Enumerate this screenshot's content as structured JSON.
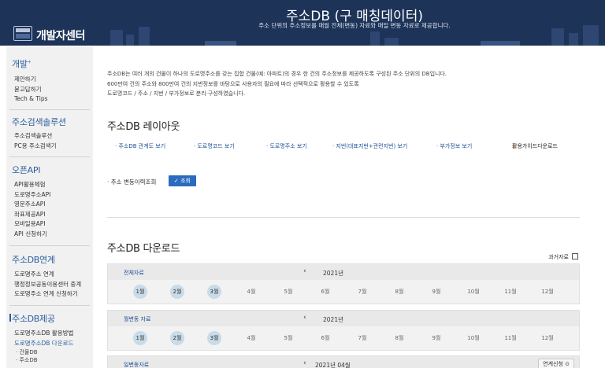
{
  "header": {
    "brand": "개발자센터",
    "title": "주소DB (구 매칭데이터)",
    "subtitle": "주소 단위의 주소정보를 매월 전체(변동) 자료와 매일 변동 자료로 제공합니다.",
    "bg_color": "#1d3358"
  },
  "sidebar": {
    "dev": {
      "title": "개발",
      "items": [
        "제안하기",
        "묻고답하기",
        "Tech & Tips"
      ]
    },
    "search": {
      "title": "주소검색솔루션",
      "items": [
        "주소검색솔루션",
        "PC용 주소검색기"
      ]
    },
    "api": {
      "title": "오픈API",
      "items": [
        "API활용체험",
        "도로명주소API",
        "영문주소API",
        "좌표제공API",
        "모바일용API",
        "API 신청하기"
      ]
    },
    "link": {
      "title": "주소DB연계",
      "items": [
        "도로명주소 연계",
        "행정정보공동이용센터 중계",
        "도로명주소 연계 신청하기"
      ]
    },
    "provide": {
      "title": "주소DB제공",
      "items": [
        "도로명주소DB 활용방법",
        "도로명주소DB 다운로드"
      ],
      "subs": [
        "· 건물DB",
        "· 주소DB"
      ]
    }
  },
  "main": {
    "desc": [
      "주소DB는 여러 개의 건물이 하나의 도로명주소를 갖는 집합 건물(예: 아파트)의 경우 한 건의 주소정보를 제공하도록 구성된 주소 단위의 DB입니다.",
      "600만여 건의 주소와 800만여 건의 지번정보를 바탕으로 사용자의 필요에 따라 선택적으로 활용할 수 있도록",
      "도로명코드 / 주소 / 지번 / 부가정보로 분리·구성하였습니다."
    ],
    "layout_title": "주소DB 레이아웃",
    "links": [
      "· 주소DB 관계도 보기",
      "· 도로명코드 보기",
      "· 도로명주소 보기",
      "· 지번(대표지번+관련지번) 보기",
      "· 부가정보 보기"
    ],
    "guide_download": "활용가이드다운로드",
    "history_label": "· 주소 변동이력조회",
    "query_button": "✓ 조회",
    "download_title": "주소DB 다운로드",
    "past_data": "과거자료",
    "panels": [
      {
        "name": "전체자료",
        "prev": "‹",
        "year": "2021년",
        "months": [
          "1월",
          "2월",
          "3월",
          "4월",
          "5월",
          "6월",
          "7월",
          "8월",
          "9월",
          "10월",
          "11월",
          "12월"
        ],
        "available": 3
      },
      {
        "name": "월변동 자료",
        "prev": "‹",
        "year": "2021년",
        "months": [
          "1월",
          "2월",
          "3월",
          "4월",
          "5월",
          "6월",
          "7월",
          "8월",
          "9월",
          "10월",
          "11월",
          "12월"
        ],
        "available": 3
      },
      {
        "name": "일변동자료",
        "prev": "‹",
        "year": "2021년 04월",
        "request": "연계신청 ⊙"
      }
    ],
    "accent_color": "#2a6bbf"
  }
}
